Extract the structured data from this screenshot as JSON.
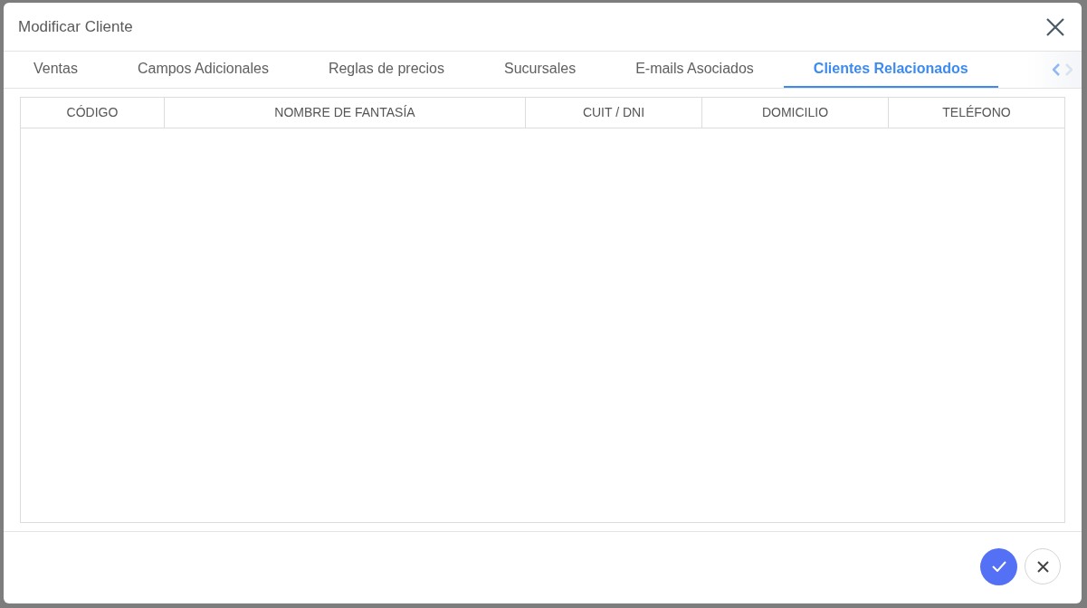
{
  "dialog": {
    "title": "Modificar Cliente"
  },
  "tabs": [
    {
      "label": "Ventas",
      "selected": false
    },
    {
      "label": "Campos Adicionales",
      "selected": false
    },
    {
      "label": "Reglas de precios",
      "selected": false
    },
    {
      "label": "Sucursales",
      "selected": false
    },
    {
      "label": "E-mails Asociados",
      "selected": false
    },
    {
      "label": "Clientes Relacionados",
      "selected": true
    }
  ],
  "table": {
    "columns": [
      "CÓDIGO",
      "NOMBRE DE FANTASÍA",
      "CUIT / DNI",
      "DOMICILIO",
      "TELÉFONO"
    ]
  }
}
